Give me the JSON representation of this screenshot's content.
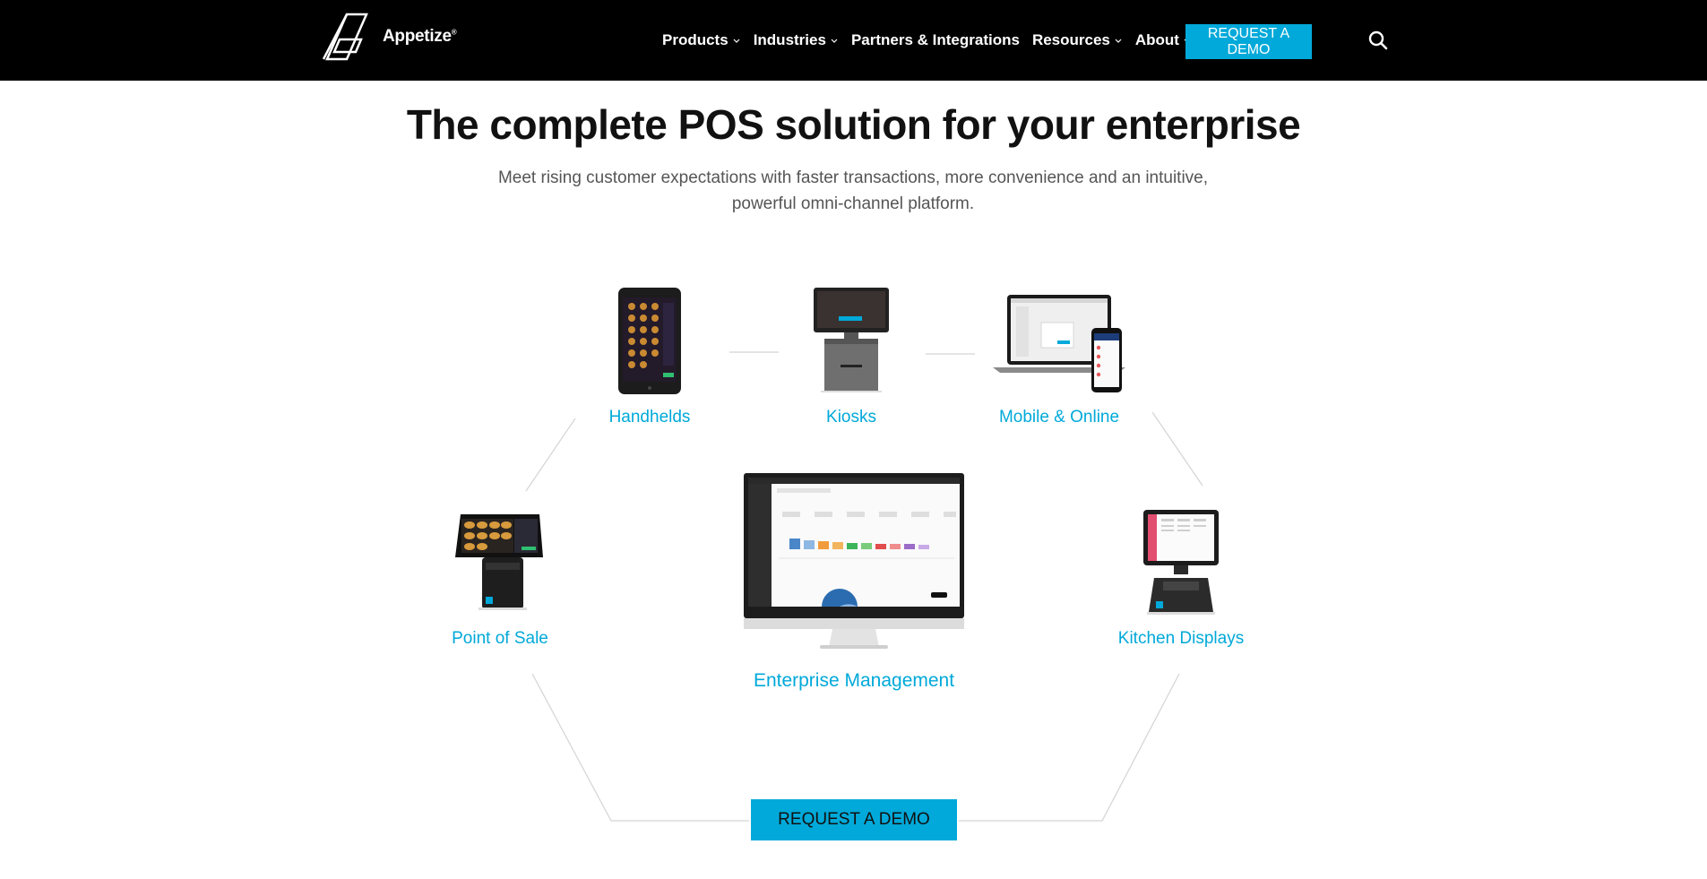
{
  "brand": {
    "name": "Appetize",
    "mark": "®"
  },
  "nav": {
    "items": [
      {
        "label": "Products",
        "dropdown": true
      },
      {
        "label": "Industries",
        "dropdown": true
      },
      {
        "label": "Partners & Integrations",
        "dropdown": false
      },
      {
        "label": "Resources",
        "dropdown": true
      },
      {
        "label": "About",
        "dropdown": true
      }
    ],
    "cta_label": "REQUEST A DEMO",
    "search_icon": "search-icon"
  },
  "hero": {
    "title": "The complete POS solution for your enterprise",
    "subtitle": "Meet rising customer expectations with faster transactions, more convenience and an intuitive, powerful omni-channel platform."
  },
  "diagram": {
    "nodes": {
      "handhelds": "Handhelds",
      "kiosks": "Kiosks",
      "mobile": "Mobile & Online",
      "pos": "Point of Sale",
      "enterprise": "Enterprise Management",
      "kitchen": "Kitchen Displays"
    },
    "cta_label": "REQUEST A DEMO"
  },
  "colors": {
    "accent": "#00a9d9",
    "header_bg": "#000000",
    "text": "#111111",
    "muted": "#555555"
  }
}
